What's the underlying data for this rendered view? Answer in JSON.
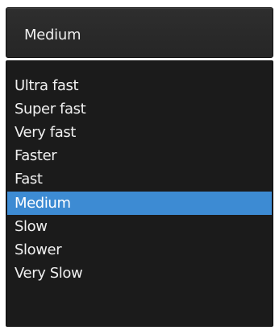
{
  "select": {
    "value": "Medium"
  },
  "options": [
    {
      "label": "Ultra fast",
      "selected": false
    },
    {
      "label": "Super fast",
      "selected": false
    },
    {
      "label": "Very fast",
      "selected": false
    },
    {
      "label": "Faster",
      "selected": false
    },
    {
      "label": "Fast",
      "selected": false
    },
    {
      "label": "Medium",
      "selected": true
    },
    {
      "label": "Slow",
      "selected": false
    },
    {
      "label": "Slower",
      "selected": false
    },
    {
      "label": "Very Slow",
      "selected": false
    }
  ],
  "colors": {
    "selected_background": "#3d8bd3",
    "list_background": "#1b1b1b",
    "text": "#f0f0f0"
  }
}
